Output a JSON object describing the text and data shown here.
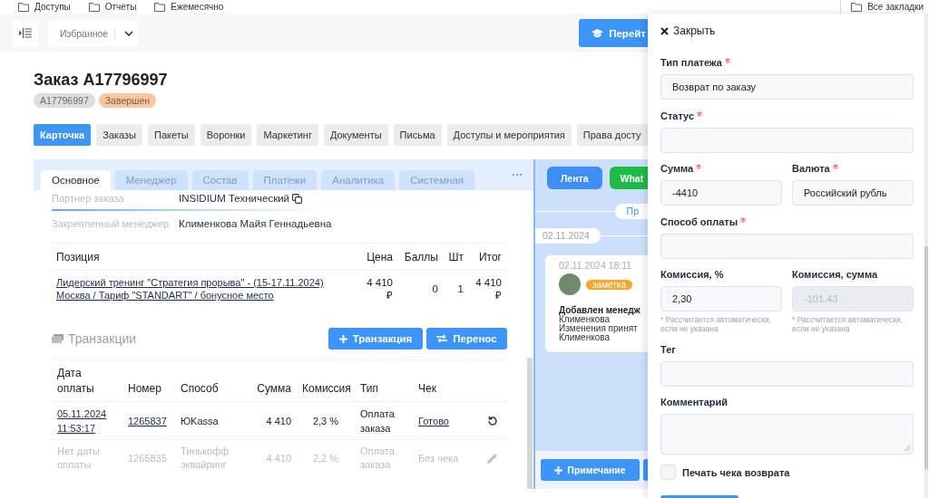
{
  "bookmarks_bar": {
    "items": [
      {
        "label": "Доступы"
      },
      {
        "label": "Отчеты"
      },
      {
        "label": "Ежемесячно"
      }
    ],
    "all_bookmarks": "Все закладки"
  },
  "toolbar": {
    "favorites": "Избранное",
    "go_button": "Перейт"
  },
  "order": {
    "title": "Заказ A17796997",
    "badges": [
      {
        "label": "A17796997",
        "color": "#dedede"
      },
      {
        "label": "Завершен",
        "color": "#fcc6a2"
      }
    ]
  },
  "tabs": [
    {
      "label": "Карточка",
      "selected": true
    },
    {
      "label": "Заказы",
      "selected": false
    },
    {
      "label": "Пакеты",
      "selected": false
    },
    {
      "label": "Воронки",
      "selected": false
    },
    {
      "label": "Маркетинг",
      "selected": false
    },
    {
      "label": "Документы",
      "selected": false
    },
    {
      "label": "Письма",
      "selected": false
    },
    {
      "label": "Доступы и мероприятия",
      "selected": false
    },
    {
      "label": "Права досту",
      "selected": false
    }
  ],
  "card": {
    "subtabs": [
      {
        "label": "Основное",
        "selected": true
      },
      {
        "label": "Менеджер",
        "selected": false
      },
      {
        "label": "Состав",
        "selected": false
      },
      {
        "label": "Платежи",
        "selected": false
      },
      {
        "label": "Аналитика",
        "selected": false
      },
      {
        "label": "Системная",
        "selected": false
      }
    ],
    "fields": [
      {
        "label": "Партнер заказа",
        "value": "INSIDIUM Технический",
        "copyable": true
      },
      {
        "label": "Закрепленный менеджер",
        "value": "Клименкова Майя Геннадьевна",
        "copyable": false
      }
    ],
    "positions": {
      "columns": [
        "Позиция",
        "Цена",
        "Баллы",
        "Шт",
        "Итог"
      ],
      "rows": [
        {
          "name": "Лидерский тренинг \"Стратегия прорыва\" - (15-17.11.2024) Москва / Тариф \"STANDART\" / бонусное место",
          "price": "4 410 ₽",
          "points": "0",
          "qty": "1",
          "total": "4 410 ₽"
        }
      ]
    },
    "transactions": {
      "title": "Транзакции",
      "buttons": [
        {
          "label": "Транзакция",
          "kind": "add"
        },
        {
          "label": "Перенос",
          "kind": "transfer"
        }
      ],
      "columns": [
        "Дата оплаты",
        "Номер",
        "Способ",
        "Сумма",
        "Комиссия",
        "Тип",
        "Чек"
      ],
      "rows": [
        {
          "date": "05.11.2024 11:53:17",
          "number": "1265837",
          "method": "ЮKassa",
          "amount": "4 410",
          "commission": "2,3 %",
          "type": "Оплата заказа",
          "receipt": "Готово",
          "disabled": false
        },
        {
          "date": "Нет даты оплаты",
          "number": "1265835",
          "method": "Тинькофф эквайринг",
          "amount": "4 410",
          "commission": "2,2 %",
          "type": "Оплата заказа",
          "receipt": "Без чека",
          "disabled": true
        }
      ]
    }
  },
  "chat": {
    "channels": [
      {
        "label": "Лента",
        "color": "#3d8ef5"
      },
      {
        "label": "What",
        "color": "#1fbb48"
      }
    ],
    "filter": "Пр",
    "date_divider": "02.11.2024",
    "messages": [
      {
        "time": "02.11.2024 18:11",
        "tag": "заметка",
        "heading": "Добавлен менедж",
        "lines": [
          "Клименкова",
          "Изменения принят",
          "Клименкова"
        ]
      }
    ],
    "note_button": "Примечание"
  },
  "drawer": {
    "close": "Закрыть",
    "rows": [
      {
        "fields": [
          {
            "label": "Тип платежа",
            "required": true,
            "kind": "input",
            "disabled": false,
            "value": "Возврат по заказу"
          }
        ]
      },
      {
        "fields": [
          {
            "label": "Статус",
            "required": true,
            "kind": "input",
            "disabled": false
          }
        ]
      },
      {
        "fields": [
          {
            "label": "Сумма",
            "required": true,
            "kind": "input",
            "disabled": false,
            "value": "-4410"
          },
          {
            "label": "Валюта",
            "required": true,
            "kind": "input",
            "disabled": false,
            "value": "Российский рубль"
          }
        ]
      },
      {
        "fields": [
          {
            "label": "Способ оплаты",
            "required": true,
            "kind": "input",
            "disabled": false
          }
        ]
      },
      {
        "fields": [
          {
            "label": "Комиссия, %",
            "required": false,
            "kind": "input",
            "disabled": false,
            "value": "2,30",
            "hint": "* Рассчитается автоматически, если не указана"
          },
          {
            "label": "Комиссия, сумма",
            "required": false,
            "kind": "input",
            "disabled": true,
            "placeholder": "-101.43",
            "hint": "* Рассчитается автоматически, если не указана"
          }
        ]
      },
      {
        "fields": [
          {
            "label": "Тег",
            "required": false,
            "kind": "input",
            "disabled": false
          }
        ]
      },
      {
        "fields": [
          {
            "label": "Комментарий",
            "required": false,
            "kind": "textarea",
            "disabled": false
          }
        ]
      }
    ],
    "print_receipt": {
      "label": "Печать чека возврата",
      "checked": false
    }
  }
}
